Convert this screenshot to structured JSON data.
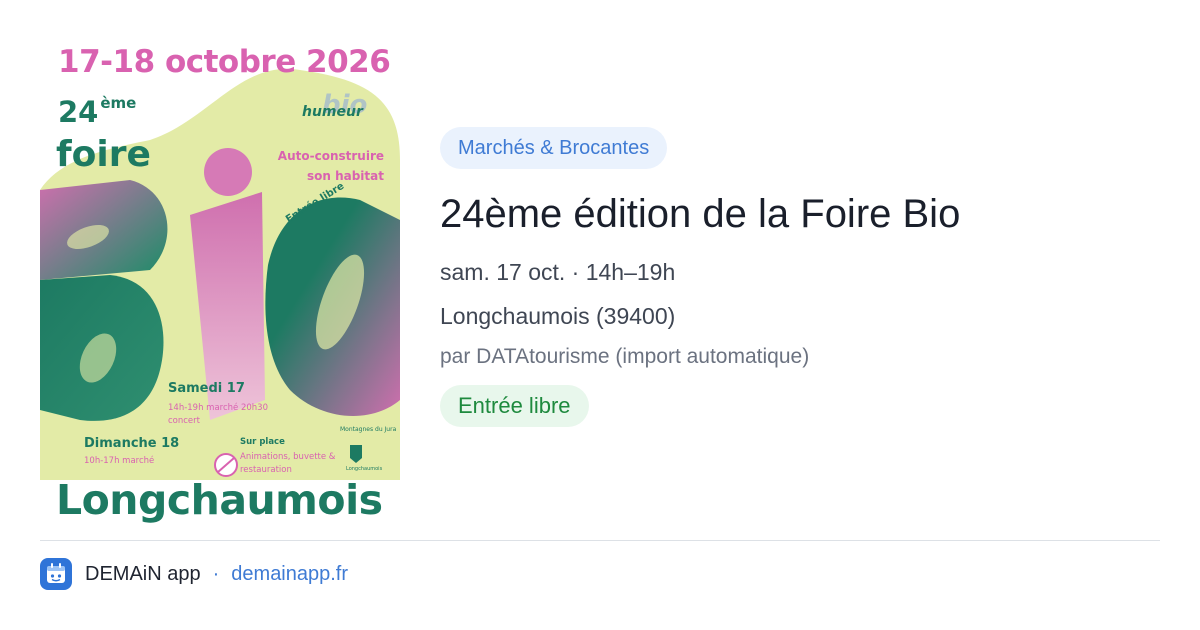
{
  "poster": {
    "dates": "17-18 octobre 2026",
    "edition_number": "24",
    "edition_suffix": "ème",
    "foire": "foire",
    "humeur": "humeur",
    "bio_script": "bio",
    "theme": "Auto-construire son habitat",
    "entree": "Entrée libre",
    "samedi_title": "Samedi 17",
    "samedi_lines": "14h-19h marché 20h30 concert",
    "dimanche_title": "Dimanche 18",
    "dimanche_lines": "10h-17h marché",
    "sur_place_title": "Sur place",
    "sur_place_lines": "Animations, buvette & restauration",
    "partner": "Montagnes du Jura",
    "mairie": "Longchaumois",
    "town": "Longchaumois"
  },
  "event": {
    "category": "Marchés & Brocantes",
    "title": "24ème édition de la Foire Bio",
    "when": "sam. 17 oct. · 14h–19h",
    "where": "Longchaumois (39400)",
    "source": "par DATAtourisme (import automatique)",
    "price_badge": "Entrée libre"
  },
  "footer": {
    "app_name": "DEMAiN app",
    "separator": "·",
    "url": "demainapp.fr"
  },
  "colors": {
    "accent_blue": "#3f7bd4",
    "chip_bg": "#eaf2fd",
    "free_green": "#1e8a3e",
    "free_bg": "#e8f7ec",
    "poster_green": "#1d7a62",
    "poster_pink": "#d962b0",
    "poster_yellow": "#e3eba7"
  }
}
